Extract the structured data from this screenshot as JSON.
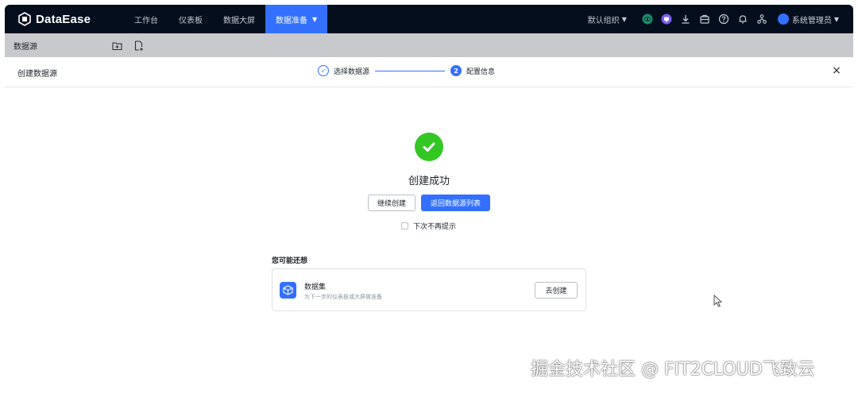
{
  "app": {
    "name": "DataEase"
  },
  "nav": {
    "items": [
      {
        "label": "工作台"
      },
      {
        "label": "仪表板"
      },
      {
        "label": "数据大屏"
      },
      {
        "label": "数据准备"
      }
    ]
  },
  "header": {
    "org": "默认组织",
    "user": "系统管理员"
  },
  "sidebar": {
    "title": "数据源"
  },
  "dialog": {
    "title": "创建数据源",
    "steps": [
      {
        "label": "选择数据源"
      },
      {
        "number": "2",
        "label": "配置信息"
      }
    ],
    "close": "×",
    "success_title": "创建成功",
    "continue_label": "继续创建",
    "back_label": "返回数据源列表",
    "remind_label": "下次不再提示",
    "suggest_title": "您可能还想",
    "card": {
      "name": "数据集",
      "description": "为下一步的仪表板或大屏做准备",
      "action": "去创建"
    }
  },
  "watermark": "掘金技术社区 @ FIT2CLOUD飞致云",
  "colors": {
    "accent": "#3370ff",
    "success": "#34c724",
    "topbar": "#050e1d"
  }
}
